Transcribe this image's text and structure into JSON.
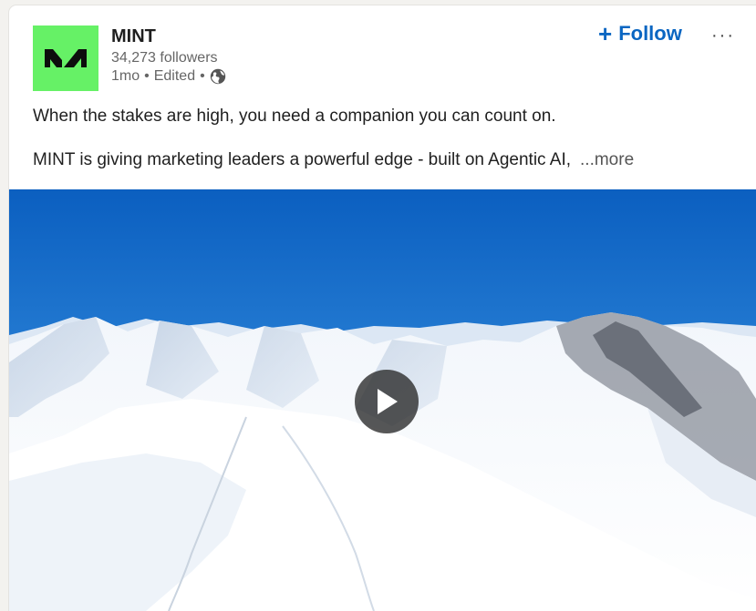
{
  "post": {
    "company": {
      "name": "MINT",
      "followers": "34,273 followers",
      "time": "1mo",
      "edited": "Edited",
      "separator": "•",
      "logo_color": "#66f166"
    },
    "follow_label": "Follow",
    "follow_plus": "+",
    "more_options": "···",
    "text": {
      "line1": "When the stakes are high, you need a companion you can count on.",
      "line2": "MINT is giving marketing leaders a powerful edge - built on Agentic AI,",
      "see_more": "...more"
    },
    "media": {
      "type": "video",
      "play_icon": "play-icon"
    },
    "accent_color": "#0a66c2"
  }
}
